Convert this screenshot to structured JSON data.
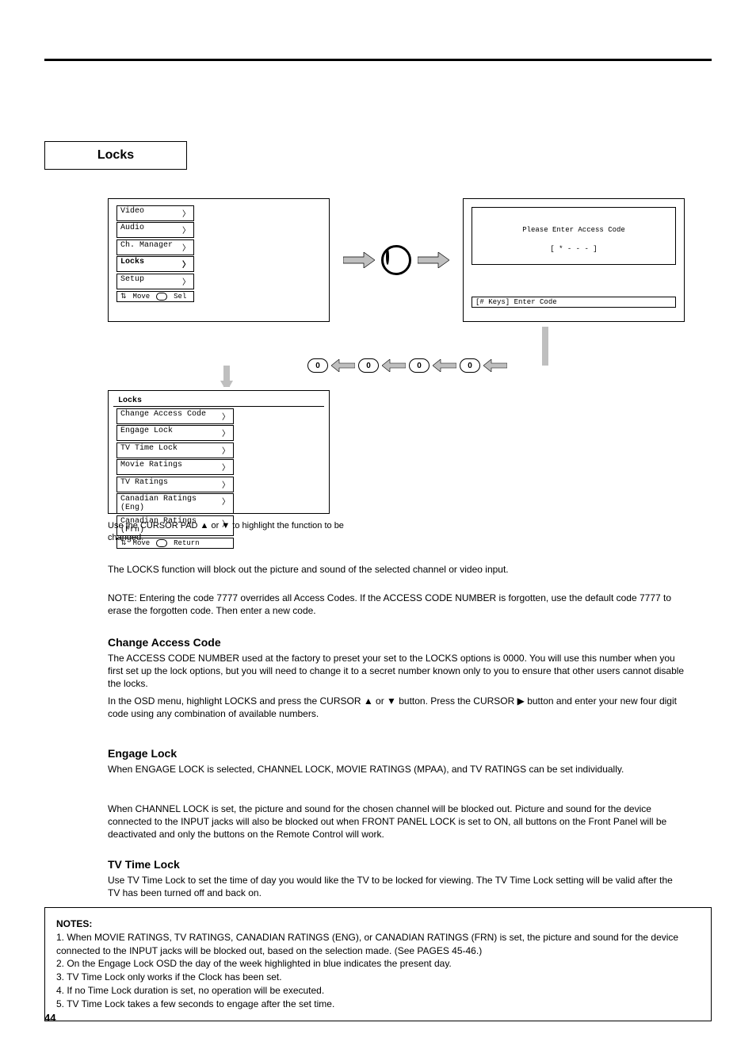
{
  "section_label": "Locks",
  "page_number": "44",
  "osd_main": {
    "items": [
      {
        "label": "Video",
        "hl": false
      },
      {
        "label": "Audio",
        "hl": false
      },
      {
        "label": "Ch. Manager",
        "hl": false
      },
      {
        "label": "Locks",
        "hl": true
      },
      {
        "label": "Setup",
        "hl": false
      }
    ],
    "footer_move": "Move",
    "footer_sel": "Sel"
  },
  "osd_code": {
    "prompt": "Please Enter Access Code",
    "mask": "[ * - - - ]",
    "hint": "[# Keys]  Enter Code"
  },
  "zero_label": "0",
  "osd_locks": {
    "title": "Locks",
    "items": [
      "Change Access Code",
      "Engage Lock",
      "TV Time Lock",
      "Movie Ratings",
      "TV Ratings",
      "Canadian Ratings (Eng)",
      "Canadian Ratings (Frn)"
    ],
    "footer_move": "Move",
    "footer_return": "Return"
  },
  "caption1": "Use the CURSOR PAD ▲ or ▼ to highlight the function to be changed.",
  "body_intro": "The LOCKS function will block out the picture and sound of the selected channel or video input.",
  "body_note": "NOTE: Entering the code 7777 overrides all Access Codes. If the ACCESS CODE NUMBER is forgotten, use the default code 7777 to erase the forgotten code. Then enter a new code.",
  "subhead_change": "Change Access Code",
  "change_p1": "The ACCESS CODE NUMBER used at the factory to preset your set to the LOCKS options is 0000. You will use this number when you first set up the lock options, but you will need to change it to a secret number known only to you to ensure that other users cannot disable the locks.",
  "change_p2": "In the OSD menu, highlight LOCKS and press the CURSOR ▲ or ▼ button. Press the CURSOR ▶ button and enter your new four digit code using any combination of available numbers.",
  "subhead_engage": "Engage Lock",
  "engage_p1": "When ENGAGE LOCK is selected, CHANNEL LOCK, MOVIE RATINGS (MPAA), and TV RATINGS can be set individually.",
  "engage_p2": "When CHANNEL LOCK is set, the picture and sound for the chosen channel will be blocked out. Picture and sound for the device connected to the INPUT jacks will also be blocked out when FRONT PANEL LOCK is set to ON, all buttons on the Front Panel will be deactivated and only the buttons on the Remote Control will work.",
  "subhead_tvtime": "TV Time Lock",
  "tvtime_p1": "Use TV Time Lock to set the time of day you would like the TV to be locked for viewing. The TV Time Lock setting will be valid after the TV has been turned off and back on.",
  "note_box": {
    "title": "NOTES:",
    "l1": "1. When MOVIE RATINGS, TV RATINGS, CANADIAN RATINGS (ENG), or CANADIAN RATINGS (FRN) is set, the picture and sound for the device connected to the INPUT jacks will be blocked out, based on the selection made. (See PAGES 45-46.)",
    "l2": "2. On the Engage Lock OSD the day of the week highlighted in blue indicates the present day.",
    "l3": "3. TV Time Lock only works if the Clock has been set.",
    "l4": "4. If no Time Lock duration is set, no operation will be executed.",
    "l5": "5. TV Time Lock takes a few seconds to engage after the set time."
  }
}
